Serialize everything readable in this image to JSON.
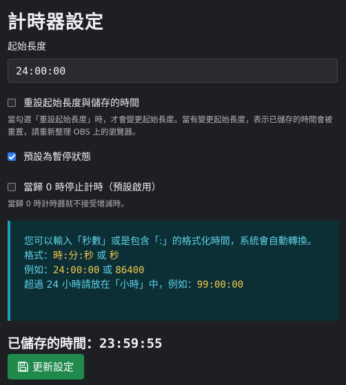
{
  "page_title": "計時器設定",
  "start_length": {
    "label": "起始長度",
    "value": "24:00:00"
  },
  "reset_option": {
    "label": "重設起始長度與儲存的時間",
    "checked": false,
    "help": "當勾選「重設起始長度」時，才會變更起始長度。當有變更起始長度，表示已儲存的時間會被重置，請重新整理 OBS 上的瀏覽器。"
  },
  "pause_option": {
    "label": "預設為暫停狀態",
    "checked": true
  },
  "stop_option": {
    "label": "當歸 0 時停止計時（預設啟用）",
    "checked": false,
    "help": "當歸 0 時計時器就不接受增減時。"
  },
  "info": {
    "intro": "您可以輸入「秒數」或是包含「:」的格式化時間，系統會自動轉換。",
    "format_prefix": "格式：",
    "format_a": "時:分:秒",
    "format_or": " 或 ",
    "format_b": "秒",
    "example_prefix": "例如：",
    "example_a": "24:00:00",
    "example_or": " 或 ",
    "example_b": "86400",
    "over_text": "超過 24 小時請放在「小時」中，例如：",
    "over_example": "99:00:00"
  },
  "saved": {
    "label": "已儲存的時間：",
    "value": "23:59:55"
  },
  "update_button": {
    "label": "更新設定",
    "icon": "floppy-disk-icon"
  },
  "colors": {
    "background": "#1e1f22",
    "info_background": "#0c2f36",
    "info_text": "#5fd3e6",
    "highlight": "#f2c94c",
    "checkbox_checked": "#3478f6",
    "button": "#1f8a4c"
  }
}
